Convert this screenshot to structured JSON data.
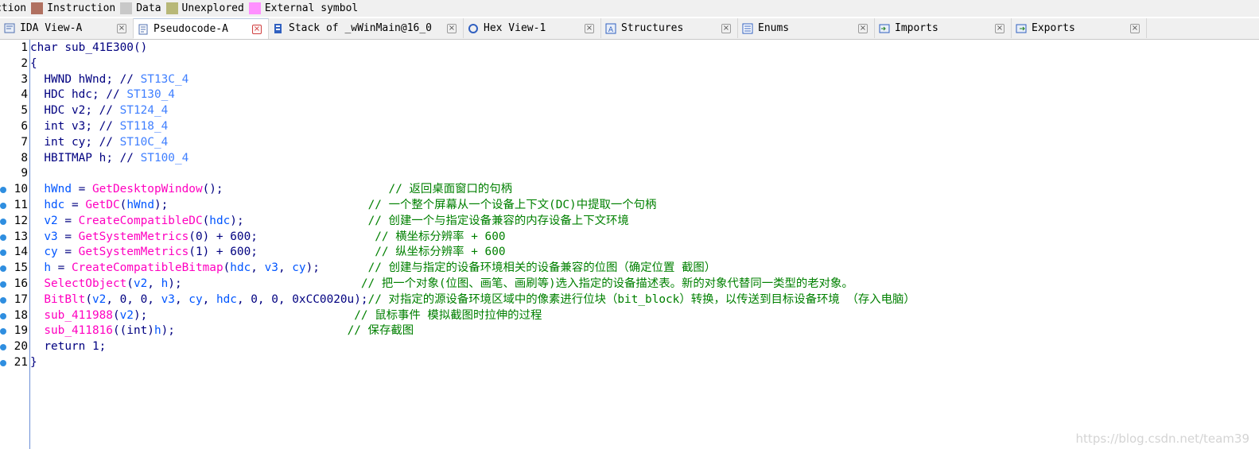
{
  "legend": [
    {
      "label": "ction",
      "color": ""
    },
    {
      "label": "Instruction",
      "color": "#b07060"
    },
    {
      "label": "Data",
      "color": "#c8c8c8"
    },
    {
      "label": "Unexplored",
      "color": "#b8b878"
    },
    {
      "label": "External symbol",
      "color": "#ff90ff"
    }
  ],
  "tabs": [
    {
      "label": "IDA View-A",
      "icon": "ida-view-icon",
      "width": 168
    },
    {
      "label": "Pseudocode-A",
      "icon": "pseudocode-icon",
      "width": 170,
      "active": true
    },
    {
      "label": "Stack of _wWinMain@16_0",
      "icon": "stack-icon",
      "width": 245
    },
    {
      "label": "Hex View-1",
      "icon": "hex-view-icon",
      "width": 173
    },
    {
      "label": "Structures",
      "icon": "structures-icon",
      "width": 172
    },
    {
      "label": "Enums",
      "icon": "enums-icon",
      "width": 172
    },
    {
      "label": "Imports",
      "icon": "imports-icon",
      "width": 172
    },
    {
      "label": "Exports",
      "icon": "exports-icon",
      "width": 170
    }
  ],
  "code": [
    {
      "n": "1",
      "dot": false,
      "tokens": [
        [
          "tp",
          "char "
        ],
        [
          "kw",
          "sub_41E300()"
        ]
      ]
    },
    {
      "n": "2",
      "dot": false,
      "tokens": [
        [
          "op",
          "{"
        ]
      ]
    },
    {
      "n": "3",
      "dot": false,
      "tokens": [
        [
          "tp",
          "  HWND hWnd"
        ],
        [
          "op",
          "; "
        ],
        [
          "op",
          "// "
        ],
        [
          "cmv",
          "ST13C_4"
        ]
      ]
    },
    {
      "n": "4",
      "dot": false,
      "tokens": [
        [
          "tp",
          "  HDC hdc"
        ],
        [
          "op",
          "; "
        ],
        [
          "op",
          "// "
        ],
        [
          "cmv",
          "ST130_4"
        ]
      ]
    },
    {
      "n": "5",
      "dot": false,
      "tokens": [
        [
          "tp",
          "  HDC v2"
        ],
        [
          "op",
          "; "
        ],
        [
          "op",
          "// "
        ],
        [
          "cmv",
          "ST124_4"
        ]
      ]
    },
    {
      "n": "6",
      "dot": false,
      "tokens": [
        [
          "tp",
          "  int v3"
        ],
        [
          "op",
          "; "
        ],
        [
          "op",
          "// "
        ],
        [
          "cmv",
          "ST118_4"
        ]
      ]
    },
    {
      "n": "7",
      "dot": false,
      "tokens": [
        [
          "tp",
          "  int cy"
        ],
        [
          "op",
          "; "
        ],
        [
          "op",
          "// "
        ],
        [
          "cmv",
          "ST10C_4"
        ]
      ]
    },
    {
      "n": "8",
      "dot": false,
      "tokens": [
        [
          "tp",
          "  HBITMAP h"
        ],
        [
          "op",
          "; "
        ],
        [
          "op",
          "// "
        ],
        [
          "cmv",
          "ST100_4"
        ]
      ]
    },
    {
      "n": "9",
      "dot": false,
      "tokens": []
    },
    {
      "n": "10",
      "dot": true,
      "tokens": [
        [
          "var",
          "  hWnd"
        ],
        [
          "op",
          " = "
        ],
        [
          "fn",
          "GetDesktopWindow"
        ],
        [
          "op",
          "();                        "
        ],
        [
          "cm",
          "// 返回桌面窗口的句柄"
        ]
      ]
    },
    {
      "n": "11",
      "dot": true,
      "tokens": [
        [
          "var",
          "  hdc"
        ],
        [
          "op",
          " = "
        ],
        [
          "fn",
          "GetDC"
        ],
        [
          "op",
          "("
        ],
        [
          "var",
          "hWnd"
        ],
        [
          "op",
          ");                             "
        ],
        [
          "cm",
          "// 一个整个屏幕从一个设备上下文(DC)中提取一个句柄"
        ]
      ]
    },
    {
      "n": "12",
      "dot": true,
      "tokens": [
        [
          "var",
          "  v2"
        ],
        [
          "op",
          " = "
        ],
        [
          "fn",
          "CreateCompatibleDC"
        ],
        [
          "op",
          "("
        ],
        [
          "var",
          "hdc"
        ],
        [
          "op",
          ");                  "
        ],
        [
          "cm",
          "// 创建一个与指定设备兼容的内存设备上下文环境"
        ]
      ]
    },
    {
      "n": "13",
      "dot": true,
      "tokens": [
        [
          "var",
          "  v3"
        ],
        [
          "op",
          " = "
        ],
        [
          "fn",
          "GetSystemMetrics"
        ],
        [
          "op",
          "(0) + 600;                 "
        ],
        [
          "cm",
          "// 横坐标分辨率 + 600"
        ]
      ]
    },
    {
      "n": "14",
      "dot": true,
      "tokens": [
        [
          "var",
          "  cy"
        ],
        [
          "op",
          " = "
        ],
        [
          "fn",
          "GetSystemMetrics"
        ],
        [
          "op",
          "(1) + 600;                 "
        ],
        [
          "cm",
          "// 纵坐标分辨率 + 600"
        ]
      ]
    },
    {
      "n": "15",
      "dot": true,
      "tokens": [
        [
          "var",
          "  h"
        ],
        [
          "op",
          " = "
        ],
        [
          "fn",
          "CreateCompatibleBitmap"
        ],
        [
          "op",
          "("
        ],
        [
          "var",
          "hdc"
        ],
        [
          "op",
          ", "
        ],
        [
          "var",
          "v3"
        ],
        [
          "op",
          ", "
        ],
        [
          "var",
          "cy"
        ],
        [
          "op",
          ");       "
        ],
        [
          "cm",
          "// 创建与指定的设备环境相关的设备兼容的位图（确定位置 截图）"
        ]
      ]
    },
    {
      "n": "16",
      "dot": true,
      "tokens": [
        [
          "fn",
          "  SelectObject"
        ],
        [
          "op",
          "("
        ],
        [
          "var",
          "v2"
        ],
        [
          "op",
          ", "
        ],
        [
          "var",
          "h"
        ],
        [
          "op",
          ");                          "
        ],
        [
          "cm",
          "// 把一个对象(位图、画笔、画刷等)选入指定的设备描述表。新的对象代替同一类型的老对象。"
        ]
      ]
    },
    {
      "n": "17",
      "dot": true,
      "tokens": [
        [
          "fn",
          "  BitBlt"
        ],
        [
          "op",
          "("
        ],
        [
          "var",
          "v2"
        ],
        [
          "op",
          ", 0, 0, "
        ],
        [
          "var",
          "v3"
        ],
        [
          "op",
          ", "
        ],
        [
          "var",
          "cy"
        ],
        [
          "op",
          ", "
        ],
        [
          "var",
          "hdc"
        ],
        [
          "op",
          ", 0, 0, 0xCC0020u);"
        ],
        [
          "cm",
          "// 对指定的源设备环境区域中的像素进行位块（bit_block）转换，以传送到目标设备环境 （存入电脑）"
        ]
      ]
    },
    {
      "n": "18",
      "dot": true,
      "tokens": [
        [
          "fn",
          "  sub_411988"
        ],
        [
          "op",
          "("
        ],
        [
          "var",
          "v2"
        ],
        [
          "op",
          ");                              "
        ],
        [
          "cm",
          "// 鼠标事件 模拟截图时拉伸的过程"
        ]
      ]
    },
    {
      "n": "19",
      "dot": true,
      "tokens": [
        [
          "fn",
          "  sub_411816"
        ],
        [
          "op",
          "((int)"
        ],
        [
          "var",
          "h"
        ],
        [
          "op",
          ");                         "
        ],
        [
          "cm",
          "// 保存截图"
        ]
      ]
    },
    {
      "n": "20",
      "dot": true,
      "tokens": [
        [
          "tp",
          "  return 1"
        ],
        [
          "op",
          ";"
        ]
      ]
    },
    {
      "n": "21",
      "dot": true,
      "tokens": [
        [
          "op",
          "}"
        ]
      ]
    }
  ],
  "watermark": "https://blog.csdn.net/team39"
}
